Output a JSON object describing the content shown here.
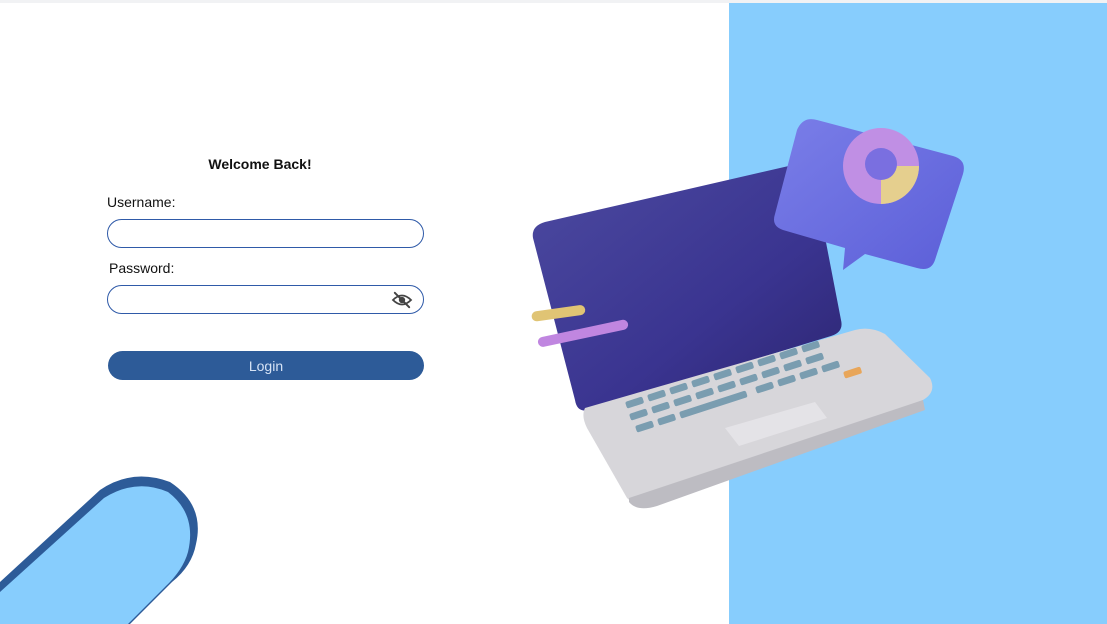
{
  "form": {
    "title": "Welcome Back!",
    "username_label": "Username:",
    "username_value": "",
    "password_label": "Password:",
    "password_value": "",
    "toggle_icon": "eye-slash-icon",
    "login_label": "Login"
  },
  "colors": {
    "accent": "#2d5b98",
    "panel": "#87cdfd",
    "input_border": "#2f5aa8"
  }
}
